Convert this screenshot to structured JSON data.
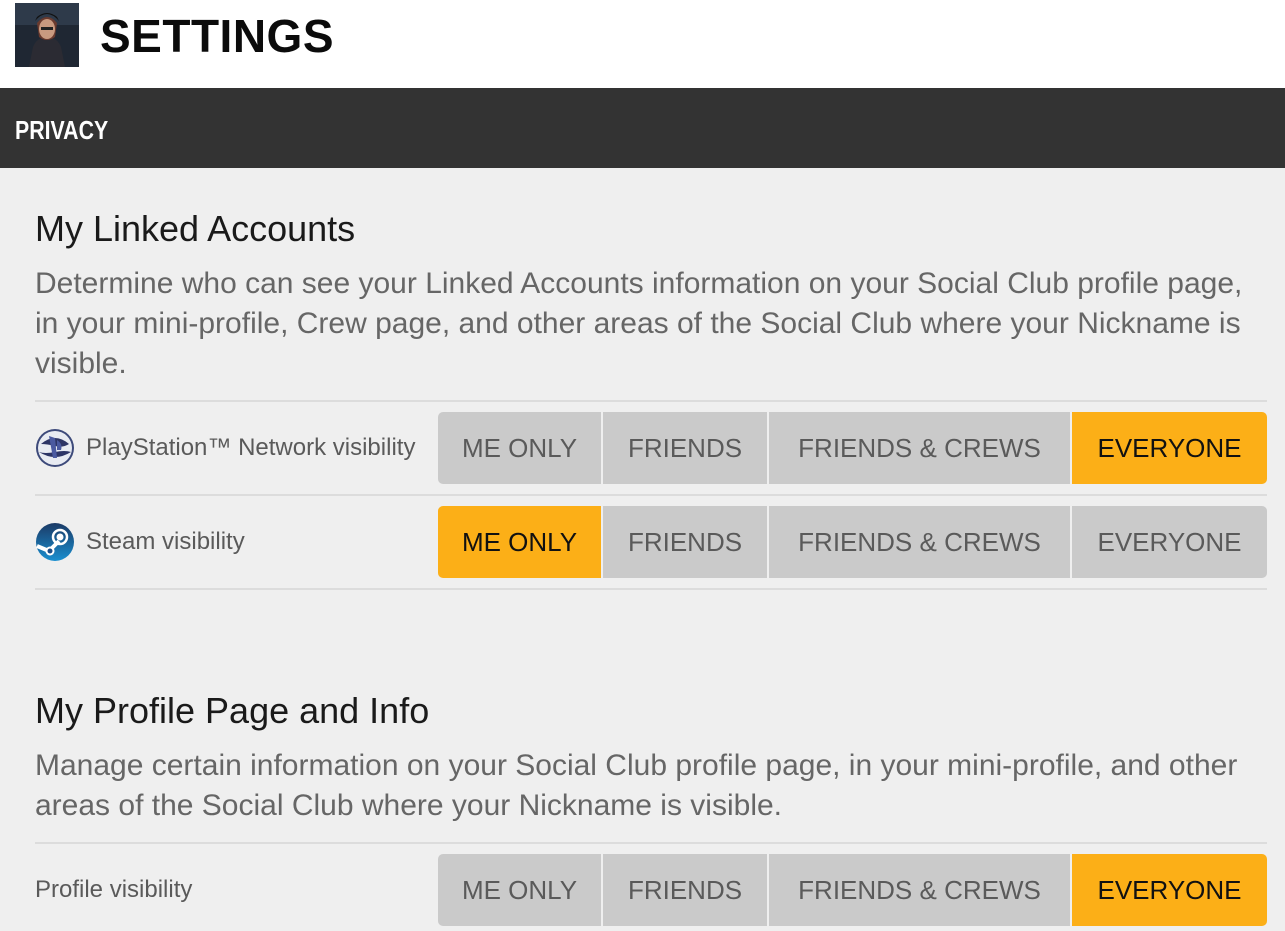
{
  "header": {
    "title": "SETTINGS"
  },
  "tab": {
    "label": "PRIVACY"
  },
  "sections": [
    {
      "title": "My Linked Accounts",
      "description": "Determine who can see your Linked Accounts information on your Social Club profile page, in your mini-profile, Crew page, and other areas of the Social Club where your Nickname is visible.",
      "rows": [
        {
          "icon": "playstation-network-icon",
          "label": "PlayStation™ Network visibility",
          "selected": "EVERYONE"
        },
        {
          "icon": "steam-icon",
          "label": "Steam visibility",
          "selected": "ME ONLY"
        }
      ]
    },
    {
      "title": "My Profile Page and Info",
      "description": "Manage certain information on your Social Club profile page, in your mini-profile, and other areas of the Social Club where your Nickname is visible.",
      "rows": [
        {
          "label": "Profile visibility",
          "selected": "EVERYONE"
        }
      ]
    }
  ],
  "options": [
    "ME ONLY",
    "FRIENDS",
    "FRIENDS & CREWS",
    "EVERYONE"
  ],
  "colors": {
    "selected": "#fcaf17",
    "unselected": "#cacaca",
    "tab_bar": "#333333",
    "content_bg": "#efefef"
  }
}
